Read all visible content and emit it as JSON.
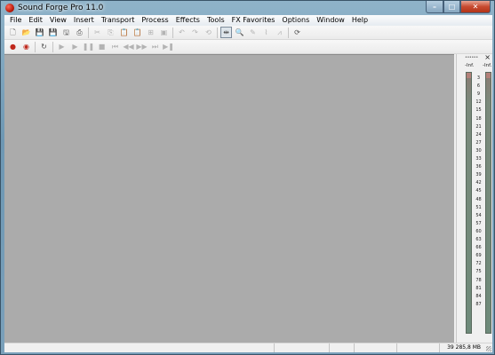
{
  "window": {
    "title": "Sound Forge Pro 11.0",
    "controls": {
      "minimize": "–",
      "maximize": "□",
      "close": "✕"
    }
  },
  "menu": [
    "File",
    "Edit",
    "View",
    "Insert",
    "Transport",
    "Process",
    "Effects",
    "Tools",
    "FX Favorites",
    "Options",
    "Window",
    "Help"
  ],
  "toolbar": {
    "new": "🗋",
    "open": "📂",
    "save": "💾",
    "save_as": "💾",
    "save_all": "🖫",
    "render": "⎙",
    "cut": "✂",
    "copy": "⎘",
    "paste": "📋",
    "paste_special": "📋",
    "mix": "⊞",
    "crop": "▣",
    "undo": "↶",
    "redo": "↷",
    "repeat": "⟲",
    "edit_tool": "⇹",
    "magnify_tool": "🔍",
    "pencil_tool": "✎",
    "envelope_tool": "⌇",
    "event_tool": "⩘",
    "refresh": "⟳"
  },
  "transport": {
    "record": "●",
    "record_arm": "◉",
    "loop": "↻",
    "play_all": "▶",
    "play": "▶",
    "pause": "❚❚",
    "stop": "■",
    "go_start": "⏮",
    "rewind": "◀◀",
    "forward": "▶▶",
    "go_end": "⏭",
    "go_end2": "▶❚"
  },
  "meters": {
    "grip": "••••••",
    "close": "×",
    "peak_left": "-Inf.",
    "peak_right": "-Inf.",
    "scale": [
      "3",
      "6",
      "9",
      "12",
      "15",
      "18",
      "21",
      "24",
      "27",
      "30",
      "33",
      "36",
      "39",
      "42",
      "45",
      "48",
      "51",
      "54",
      "57",
      "60",
      "63",
      "66",
      "69",
      "72",
      "75",
      "78",
      "81",
      "84",
      "87"
    ]
  },
  "status": {
    "memory": "39 285,8 MB"
  }
}
